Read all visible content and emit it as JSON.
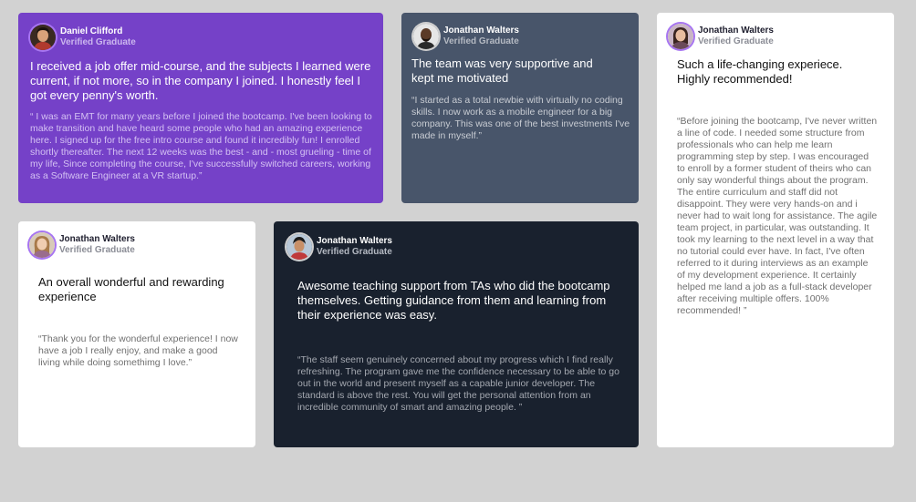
{
  "testimonials": [
    {
      "name": "Daniel Clifford",
      "role": "Verified Graduate",
      "headline": "I received a job offer mid-course, and the subjects I learned were current, if not more, so in the company I joined. I honestly feel I got every penny's worth.",
      "quote": "“ I was an EMT for many years before I joined the bootcamp. I've been looking to make transition and have heard some people who had an amazing experience here. I signed up for the free intro course and found it incredibly fun! I enrolled shortly thereafter. The next 12 weeks was the best - and - most grueling - time of my life, Since completing the course, I've successfully switched careers, working as a Software Engineer at a VR startup.”",
      "bg": "#7541c8"
    },
    {
      "name": "Jonathan Walters",
      "role": "Verified Graduate",
      "headline": "The team was very supportive and kept me motivated",
      "quote": "“I started as a total newbie with virtually no coding skills. I now work as a mobile engineer for a big company. This was one of the best investments I've made in myself.”",
      "bg": "#48556a"
    },
    {
      "name": "Jonathan Walters",
      "role": "Verified Graduate",
      "headline": "Such a life-changing experiece. Highly recommended!",
      "quote": "“Before joining the bootcamp, I've never written a line of code. I needed some structure from professionals who can help me learn programming step by step. I was encouraged to enroll by a former student of theirs who can only say wonderful things about the program. The entire curriculum and staff did not disappoint. They were very hands-on and i never had to wait long for assistance. The agile team project, in particular, was outstanding. It took my learning to the next level in a way that no tutorial could ever have. In fact, I've often referred to it during interviews as an example of my development experience. It certainly helped me land a job as a full-stack developer after receiving multiple offers. 100% recommended! ”",
      "bg": "#ffffff"
    },
    {
      "name": "Jonathan Walters",
      "role": "Verified Graduate",
      "headline": "An overall wonderful and rewarding experience",
      "quote": "“Thank you for the wonderful experience! I now have a job I really enjoy, and make a good living while doing somethimg I love.”",
      "bg": "#ffffff"
    },
    {
      "name": "Jonathan Walters",
      "role": "Verified Graduate",
      "headline": "Awesome teaching support from TAs who did the bootcamp themselves. Getting guidance from them and learning from their experience was easy.",
      "quote": "“The staff seem genuinely concerned about my progress which I find really refreshing. The program gave me the confidence necessary to be able to go out in the world and present myself as a capable junior developer. The standard is above the rest. You will get the personal attention from an incredible community of smart and amazing people. ”",
      "bg": "#19212e"
    }
  ],
  "colors": {
    "page_bg": "#d2d2d2",
    "purple": "#7541c8",
    "slate": "#48556a",
    "navy": "#19212e",
    "white": "#ffffff"
  }
}
